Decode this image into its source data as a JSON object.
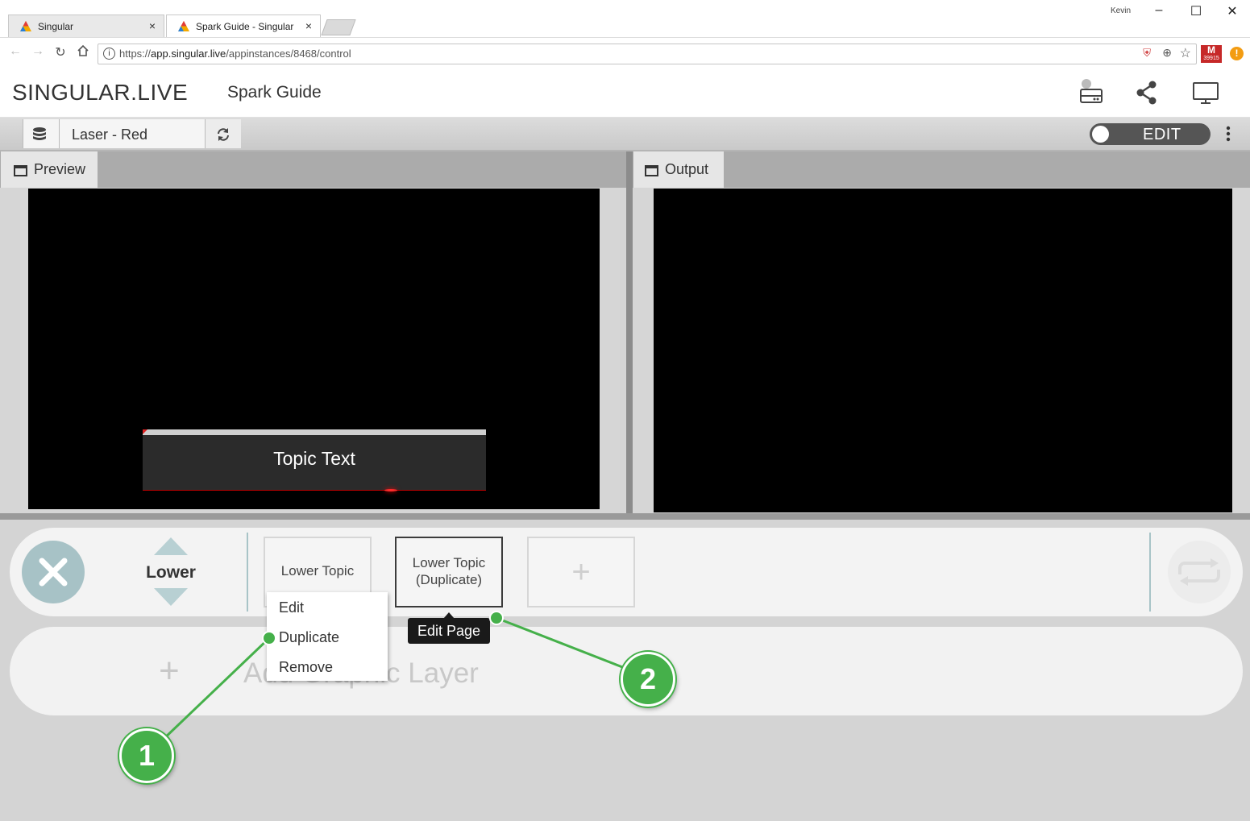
{
  "browser": {
    "tabs": [
      {
        "title": "Singular",
        "close": "×"
      },
      {
        "title": "Spark Guide - Singular",
        "close": "×"
      }
    ],
    "user": "Kevin",
    "window_controls": {
      "minimize": "–",
      "maximize": "☐",
      "close": "✕"
    },
    "url_scheme": "https://",
    "url_host": "app.singular.live",
    "url_path": "/appinstances/8468/control",
    "ext_badge": "39915"
  },
  "app": {
    "logo": "SINGULAR.LIVE",
    "project_title": "Spark Guide",
    "composition": "Laser - Red",
    "edit_toggle": "EDIT"
  },
  "panes": {
    "preview": "Preview",
    "output": "Output"
  },
  "preview": {
    "lower_third_text": "Topic Text"
  },
  "layer": {
    "name": "Lower",
    "pages": [
      {
        "label": "Lower Topic"
      },
      {
        "label": "Lower Topic (Duplicate)",
        "line1": "Lower Topic",
        "line2": "(Duplicate)"
      }
    ],
    "add_page": "+",
    "add_layer_plus": "+",
    "add_layer_text": "Add Graphic Layer"
  },
  "context_menu": {
    "items": [
      "Edit",
      "Duplicate",
      "Remove"
    ]
  },
  "tooltip": "Edit Page",
  "annotations": [
    "1",
    "2"
  ],
  "colors": {
    "accent_green": "#45b04a",
    "clear_button": "#a7c2c6",
    "edit_toggle": "#555555"
  }
}
